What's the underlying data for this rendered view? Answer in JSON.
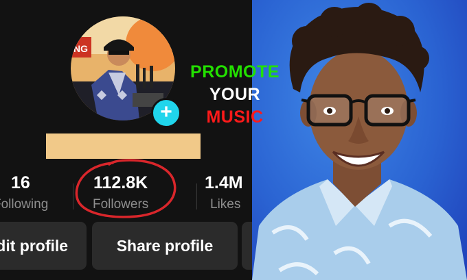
{
  "profile": {
    "stats": [
      {
        "value": "16",
        "label": "Following"
      },
      {
        "value": "112.8K",
        "label": "Followers"
      },
      {
        "value": "1.4M",
        "label": "Likes"
      }
    ],
    "buttons": {
      "edit": "Edit profile",
      "share": "Share profile"
    }
  },
  "promo": {
    "line1": "PROMOTE",
    "line2": "YOUR",
    "line3": "MUSIC",
    "colors": {
      "line1": "#23e000",
      "line2": "#ffffff",
      "line3": "#ff1a1a"
    }
  },
  "colors": {
    "background": "#121212",
    "plus_badge": "#20d5ec",
    "circle_marker": "#d9262b",
    "name_placeholder": "#f1c989"
  }
}
